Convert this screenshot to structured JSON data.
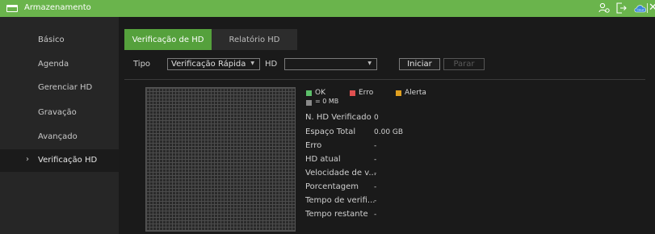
{
  "window": {
    "title": "Armazenamento",
    "accent_color": "#6ab44c",
    "icons": [
      "drive-icon",
      "user-settings-icon",
      "exit-icon",
      "cloud-icon",
      "close-icon"
    ],
    "cloud_label": "Cloud"
  },
  "sidebar": {
    "items": [
      {
        "label": "Básico"
      },
      {
        "label": "Agenda"
      },
      {
        "label": "Gerenciar HD"
      },
      {
        "label": "Gravação"
      },
      {
        "label": "Avançado"
      },
      {
        "label": "Verificação HD",
        "active": true
      }
    ]
  },
  "tabs": [
    {
      "label": "Verificação de HD",
      "active": true
    },
    {
      "label": "Relatório HD"
    }
  ],
  "form": {
    "type_label": "Tipo",
    "type_value": "Verificação Rápida",
    "hd_label": "HD",
    "hd_value": "",
    "start_label": "Iniciar",
    "stop_label": "Parar"
  },
  "legend": {
    "ok": {
      "label": "OK",
      "color": "#5cc06a"
    },
    "error": {
      "label": "Erro",
      "color": "#e05050"
    },
    "alert": {
      "label": "Alerta",
      "color": "#e0a020"
    },
    "unit": {
      "label": "= 0 MB",
      "color": "#8a8a8a"
    }
  },
  "info": [
    {
      "label": "N. HD Verificado",
      "value": "0"
    },
    {
      "label": "Espaço Total",
      "value": "0.00 GB"
    },
    {
      "label": "Erro",
      "value": "-"
    },
    {
      "label": "HD atual",
      "value": "-"
    },
    {
      "label": "Velocidade de v...",
      "value": "-"
    },
    {
      "label": "Porcentagem",
      "value": "-"
    },
    {
      "label": "Tempo de verifi...",
      "value": "-"
    },
    {
      "label": "Tempo restante",
      "value": "-"
    }
  ]
}
